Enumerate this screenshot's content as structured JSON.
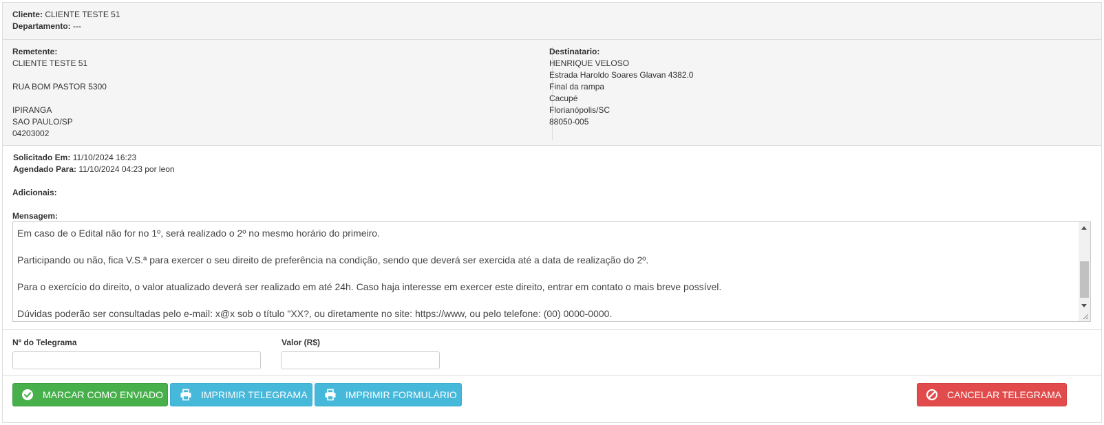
{
  "client": {
    "client_label": "Cliente:",
    "client_value": "CLIENTE TESTE 51",
    "dept_label": "Departamento:",
    "dept_value": "---"
  },
  "sender": {
    "label": "Remetente:",
    "lines": [
      "CLIENTE TESTE 51",
      "",
      "RUA BOM PASTOR 5300",
      "",
      "IPIRANGA",
      "SAO PAULO/SP",
      "04203002"
    ]
  },
  "recipient": {
    "label": "Destinatario:",
    "lines": [
      "HENRIQUE VELOSO",
      "Estrada Haroldo Soares Glavan 4382.0",
      "Final da rampa",
      "Cacupé",
      "Florianópolis/SC",
      "88050-005"
    ]
  },
  "dates": {
    "requested_label": "Solicitado Em:",
    "requested_value": "11/10/2024 16:23",
    "scheduled_label": "Agendado Para:",
    "scheduled_value": "11/10/2024 04:23 por leon"
  },
  "additional_label": "Adicionais:",
  "message": {
    "label": "Mensagem:",
    "paragraphs": [
      "Em caso de o Edital não for no 1º, será realizado o 2º no mesmo horário do primeiro.",
      "",
      "Participando ou não, fica V.S.ª para exercer o seu direito de preferência na condição, sendo que deverá ser exercida até a data de realização do 2º.",
      "",
      "Para o exercício do direito, o valor atualizado deverá ser realizado em até 24h. Caso haja interesse em exercer este direito, entrar em contato o mais breve possível.",
      "",
      "Dúvidas poderão ser consultadas pelo e-mail: x@x sob o título \"XX?, ou diretamente no site: https://www, ou pelo telefone: (00) 0000-0000."
    ]
  },
  "fields": {
    "telegram_number_label": "Nº do Telegrama",
    "telegram_number_value": "",
    "value_label": "Valor (R$)",
    "value_value": ""
  },
  "buttons": {
    "mark_sent": "MARCAR COMO ENVIADO",
    "print_telegram": "IMPRIMIR TELEGRAMA",
    "print_form": "IMPRIMIR FORMULÁRIO",
    "cancel": "CANCELAR TELEGRAMA"
  },
  "colors": {
    "success": "#47b04b",
    "info": "#46b8da",
    "danger": "#e24b4b",
    "panel_bg": "#f5f5f5"
  },
  "icons": {
    "mark_sent": "check-circle-icon",
    "print_telegram": "printer-icon",
    "print_form": "printer-icon",
    "cancel": "ban-icon"
  }
}
